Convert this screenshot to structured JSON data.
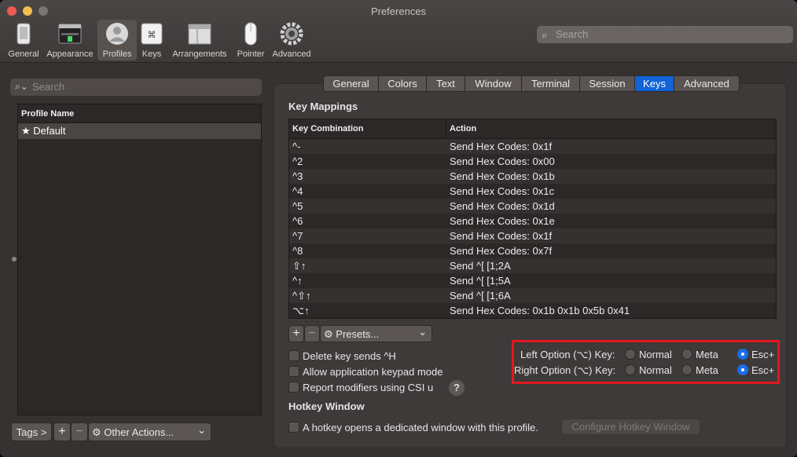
{
  "window": {
    "title": "Preferences"
  },
  "toolbar": {
    "items": [
      {
        "label": "General",
        "icon": "general-icon",
        "selected": false
      },
      {
        "label": "Appearance",
        "icon": "appearance-icon",
        "selected": false
      },
      {
        "label": "Profiles",
        "icon": "profiles-icon",
        "selected": true
      },
      {
        "label": "Keys",
        "icon": "keys-icon",
        "selected": false
      },
      {
        "label": "Arrangements",
        "icon": "arrangements-icon",
        "selected": false
      },
      {
        "label": "Pointer",
        "icon": "pointer-icon",
        "selected": false
      },
      {
        "label": "Advanced",
        "icon": "advanced-icon",
        "selected": false
      }
    ],
    "search_placeholder": "Search"
  },
  "sidebar": {
    "search_placeholder": "Search",
    "column_header": "Profile Name",
    "profiles": [
      {
        "name": "Default",
        "star": "★"
      }
    ],
    "tags_button": "Tags >",
    "add_button": "+",
    "remove_button": "−",
    "other_actions": "Other Actions...",
    "other_actions_chevron": "⌄"
  },
  "tabs": [
    {
      "label": "General",
      "active": false
    },
    {
      "label": "Colors",
      "active": false
    },
    {
      "label": "Text",
      "active": false
    },
    {
      "label": "Window",
      "active": false
    },
    {
      "label": "Terminal",
      "active": false
    },
    {
      "label": "Session",
      "active": false
    },
    {
      "label": "Keys",
      "active": true
    },
    {
      "label": "Advanced",
      "active": false
    }
  ],
  "key_mappings": {
    "title": "Key Mappings",
    "col_key": "Key Combination",
    "col_action": "Action",
    "rows": [
      {
        "key": "^-",
        "action": "Send Hex Codes: 0x1f"
      },
      {
        "key": "^2",
        "action": "Send Hex Codes: 0x00"
      },
      {
        "key": "^3",
        "action": "Send Hex Codes: 0x1b"
      },
      {
        "key": "^4",
        "action": "Send Hex Codes: 0x1c"
      },
      {
        "key": "^5",
        "action": "Send Hex Codes: 0x1d"
      },
      {
        "key": "^6",
        "action": "Send Hex Codes: 0x1e"
      },
      {
        "key": "^7",
        "action": "Send Hex Codes: 0x1f"
      },
      {
        "key": "^8",
        "action": "Send Hex Codes: 0x7f"
      },
      {
        "key": "⇧↑",
        "action": "Send ^[ [1;2A"
      },
      {
        "key": "^↑",
        "action": "Send ^[ [1;5A"
      },
      {
        "key": "^⇧↑",
        "action": "Send ^[ [1;6A"
      },
      {
        "key": "⌥↑",
        "action": "Send Hex Codes: 0x1b 0x1b 0x5b 0x41"
      }
    ],
    "add_button": "+",
    "remove_button": "−",
    "presets_label": "Presets...",
    "presets_chevron": "⌄"
  },
  "options": {
    "delete_sends_h": {
      "label": "Delete key sends ^H",
      "checked": false
    },
    "app_keypad": {
      "label": "Allow application keypad mode",
      "checked": false
    },
    "csi_u": {
      "label": "Report modifiers using CSI u",
      "checked": false
    },
    "help": "?"
  },
  "option_keys": {
    "left": {
      "label": "Left Option (⌥) Key:",
      "selected": "Esc+"
    },
    "right": {
      "label": "Right Option (⌥) Key:",
      "selected": "Esc+"
    },
    "choices": [
      "Normal",
      "Meta",
      "Esc+"
    ]
  },
  "hotkey": {
    "title": "Hotkey Window",
    "checkbox_label": "A hotkey opens a dedicated window with this profile.",
    "checked": false,
    "configure_button": "Configure Hotkey Window"
  },
  "colors": {
    "accent": "#1063d8",
    "highlight": "#e3181f",
    "close": "#ee5a52",
    "minimize": "#f5bd4f",
    "zoom": "#7a7573"
  }
}
